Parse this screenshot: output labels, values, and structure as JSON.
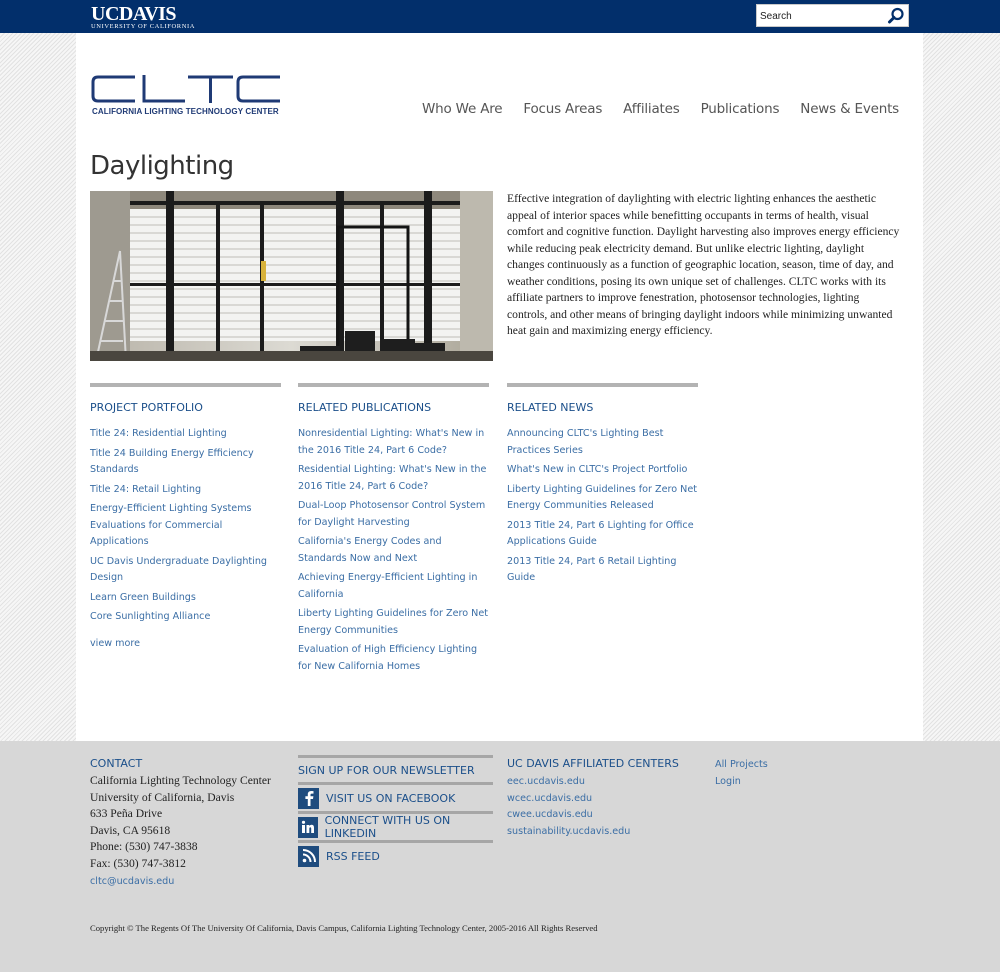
{
  "topbar": {
    "logo_main": "UCDAVIS",
    "logo_sub": "UNIVERSITY OF CALIFORNIA",
    "search_placeholder": "Search"
  },
  "header": {
    "logo_text": "CLTC",
    "logo_tagline": "CALIFORNIA LIGHTING TECHNOLOGY CENTER",
    "nav": [
      "Who We Are",
      "Focus Areas",
      "Affiliates",
      "Publications",
      "News & Events"
    ]
  },
  "page": {
    "title": "Daylighting",
    "intro": "Effective integration of daylighting with electric lighting enhances the aesthetic appeal of interior spaces while benefitting occupants in terms of health, visual comfort and cognitive function. Daylight harvesting also improves energy efficiency while reducing peak electricity demand. But unlike electric lighting, daylight changes continuously as a function of geographic location, season, time of day, and weather conditions, posing its own unique set of challenges. CLTC works with its affiliate partners to improve fenestration, photosensor technologies, lighting controls, and other means of bringing daylight indoors while minimizing unwanted heat gain and maximizing energy efficiency."
  },
  "portfolio": {
    "heading": "PROJECT PORTFOLIO",
    "items": [
      "Title 24: Residential Lighting",
      "Title 24 Building Energy Efficiency Standards",
      "Title 24: Retail Lighting",
      "Energy-Efficient Lighting Systems Evaluations for Commercial Applications",
      "UC Davis Undergraduate Daylighting Design",
      "Learn Green Buildings",
      "Core Sunlighting Alliance"
    ],
    "more": "view more"
  },
  "publications": {
    "heading": "RELATED PUBLICATIONS",
    "items": [
      "Nonresidential Lighting: What's New in the 2016 Title 24, Part 6 Code?",
      "Residential Lighting: What's New in the 2016 Title 24, Part 6 Code?",
      "Dual-Loop Photosensor Control System for Daylight Harvesting",
      "California's Energy Codes and Standards Now and Next",
      "Achieving Energy-Efficient Lighting in California",
      "Liberty Lighting Guidelines for Zero Net Energy Communities",
      "Evaluation of High Efficiency Lighting for New California Homes"
    ]
  },
  "news": {
    "heading": "RELATED NEWS",
    "items": [
      "Announcing CLTC's Lighting Best Practices Series",
      "What's New in CLTC's Project Portfolio",
      "Liberty Lighting Guidelines for Zero Net Energy Communities Released",
      "2013 Title 24, Part 6 Lighting for Office Applications Guide",
      "2013 Title 24, Part 6 Retail Lighting Guide"
    ]
  },
  "footer": {
    "contact_heading": "CONTACT",
    "contact_lines": [
      "California Lighting Technology Center",
      "University of California, Davis",
      "633 Peña Drive",
      "Davis, CA 95618",
      "Phone: (530) 747-3838",
      "Fax: (530) 747-3812"
    ],
    "email": "cltc@ucdavis.edu",
    "newsletter": "SIGN UP FOR OUR NEWSLETTER",
    "facebook": "VISIT US ON FACEBOOK",
    "linkedin": "CONNECT WITH US ON LINKEDIN",
    "rss": "RSS FEED",
    "centers_heading": "UC DAVIS AFFILIATED CENTERS",
    "centers": [
      "eec.ucdavis.edu",
      "wcec.ucdavis.edu",
      "cwee.ucdavis.edu",
      "sustainability.ucdavis.edu"
    ],
    "misc": [
      "All Projects",
      "Login"
    ],
    "copyright": "Copyright © The Regents Of The University Of California, Davis Campus, California Lighting Technology Center, 2005-2016 All Rights Reserved"
  },
  "colors": {
    "topbar": "#022f6b",
    "link": "#3b6ea5",
    "heading": "#1b4f8a",
    "logo": "#1f3a75"
  },
  "icons": [
    "search-icon",
    "facebook-icon",
    "linkedin-icon",
    "rss-icon"
  ]
}
